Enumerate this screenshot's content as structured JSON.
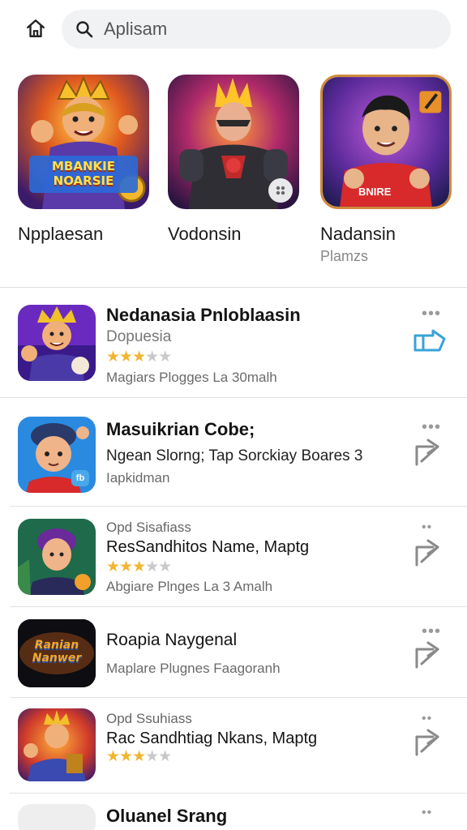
{
  "search": {
    "placeholder": "Aplisam"
  },
  "featured": [
    {
      "name": "Npplaesan",
      "sub": ""
    },
    {
      "name": "Vodonsin",
      "sub": ""
    },
    {
      "name": "Nadansin",
      "sub": "Plamzs"
    }
  ],
  "featured_badges": {
    "logo_text_1": "MBANKIE",
    "logo_text_2": "NOARSIE",
    "shirt_text": "BNIRE"
  },
  "list": [
    {
      "pre": "",
      "title": "Nedanasia Pnloblaasin",
      "sub": "Dopuesia",
      "rating": 3,
      "meta": "Magiars Plogges La 30malh",
      "badge": ""
    },
    {
      "pre": "",
      "title": "Masuikrian Cobe;",
      "sub": "Ngean Slorng; Tap Sorckiay Boares 3",
      "rating": null,
      "meta": "Iapkidman",
      "badge": "fb"
    },
    {
      "pre": "Opd Sisafiass",
      "title": "ResSandhitos Name, Maptg",
      "sub": "",
      "rating": 3,
      "meta": "Abgiare Plnges La 3 Amalh",
      "badge": ""
    },
    {
      "pre": "",
      "title": "Roapia Naygenal",
      "sub": "",
      "rating": null,
      "meta": "Maplare Plugnes Faagoranh",
      "badge": ""
    },
    {
      "pre": "Opd Ssuhiass",
      "title": "Rac Sandhtiag Nkans, Maptg",
      "sub": "",
      "rating": 3,
      "meta": "",
      "badge": ""
    },
    {
      "pre": "",
      "title": "Oluanel Srang",
      "sub": "",
      "rating": null,
      "meta": "",
      "badge": ""
    }
  ],
  "list_logo": {
    "line1": "Ranian",
    "line2": "Nanwer"
  },
  "colors": {
    "accent": "#3aa3d8",
    "star": "#f2b531",
    "star_off": "#c9c9c9",
    "divider": "#e3e3e3"
  }
}
